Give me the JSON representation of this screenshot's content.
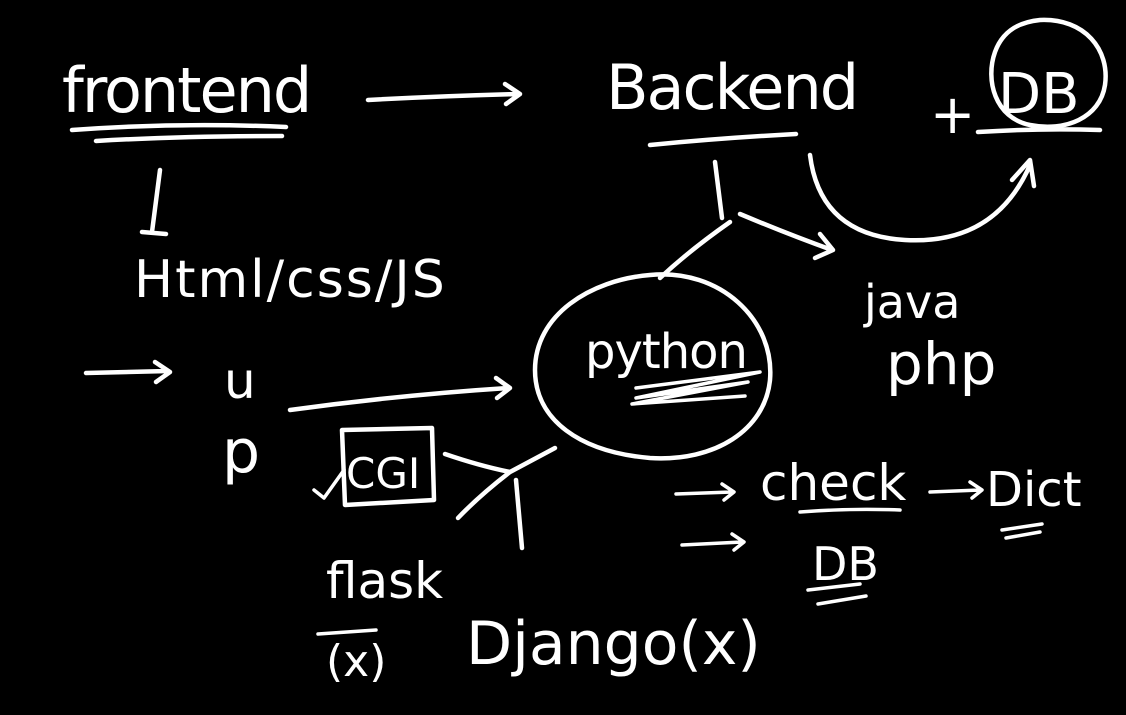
{
  "canvas": {
    "background": "#000000",
    "ink": "#ffffff"
  },
  "labels": {
    "frontend": "frontend",
    "backend": "Backend",
    "plus": "+",
    "db": "DB",
    "html_css_js": "Html/css/JS",
    "java": "java",
    "php": "php",
    "python": "python",
    "u": "u",
    "p": "p",
    "cgi": "CGI",
    "check": "check",
    "dict": "Dict",
    "db2": "DB",
    "flask": "flask",
    "flask_note": "(x)",
    "django": "Django(x)"
  }
}
